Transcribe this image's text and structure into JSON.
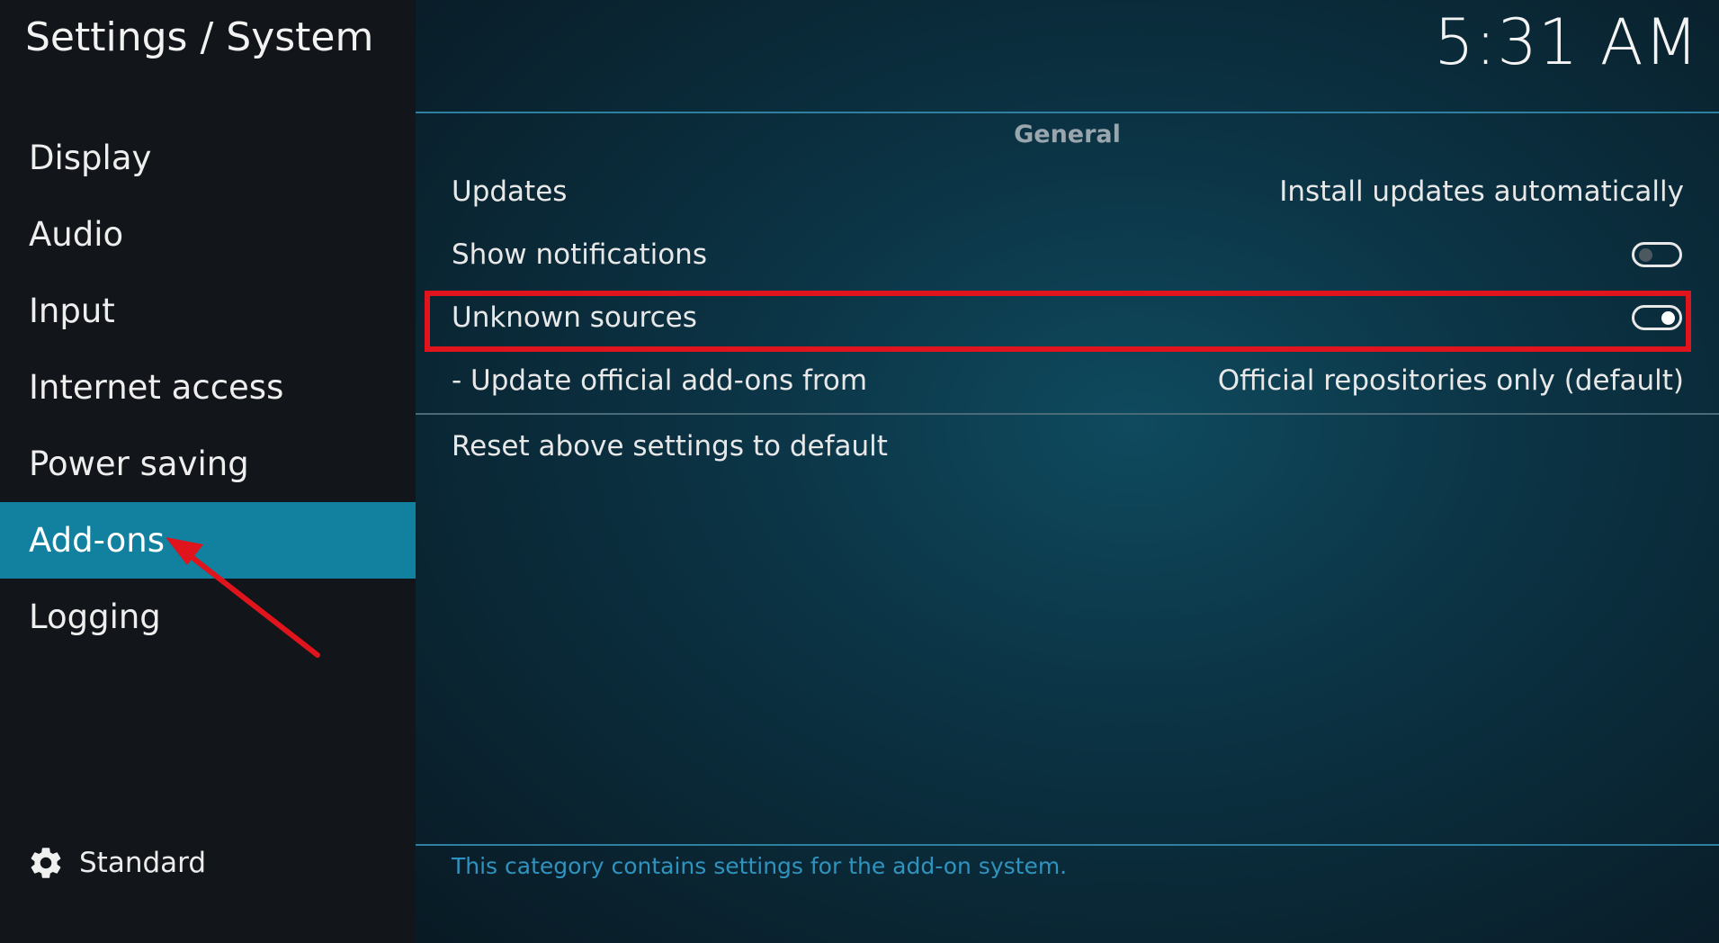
{
  "header": {
    "title": "Settings / System",
    "clock": "5:31 AM"
  },
  "sidebar": {
    "items": [
      {
        "label": "Display"
      },
      {
        "label": "Audio"
      },
      {
        "label": "Input"
      },
      {
        "label": "Internet access"
      },
      {
        "label": "Power saving"
      },
      {
        "label": "Add-ons",
        "selected": true
      },
      {
        "label": "Logging"
      }
    ],
    "settings_level": {
      "icon": "gear-icon",
      "label": "Standard"
    }
  },
  "main": {
    "group": "General",
    "settings": {
      "updates": {
        "label": "Updates",
        "value": "Install updates automatically"
      },
      "show_notifications": {
        "label": "Show notifications",
        "enabled": false
      },
      "unknown_sources": {
        "label": "Unknown sources",
        "enabled": true
      },
      "update_official": {
        "label": "- Update official add-ons from",
        "value": "Official repositories only (default)"
      }
    },
    "reset_label": "Reset above settings to default",
    "description": "This category contains settings for the add-on system."
  },
  "colors": {
    "selected_item": "#12809f",
    "annotation": "#e0141c",
    "description_text": "#2f93bf"
  }
}
